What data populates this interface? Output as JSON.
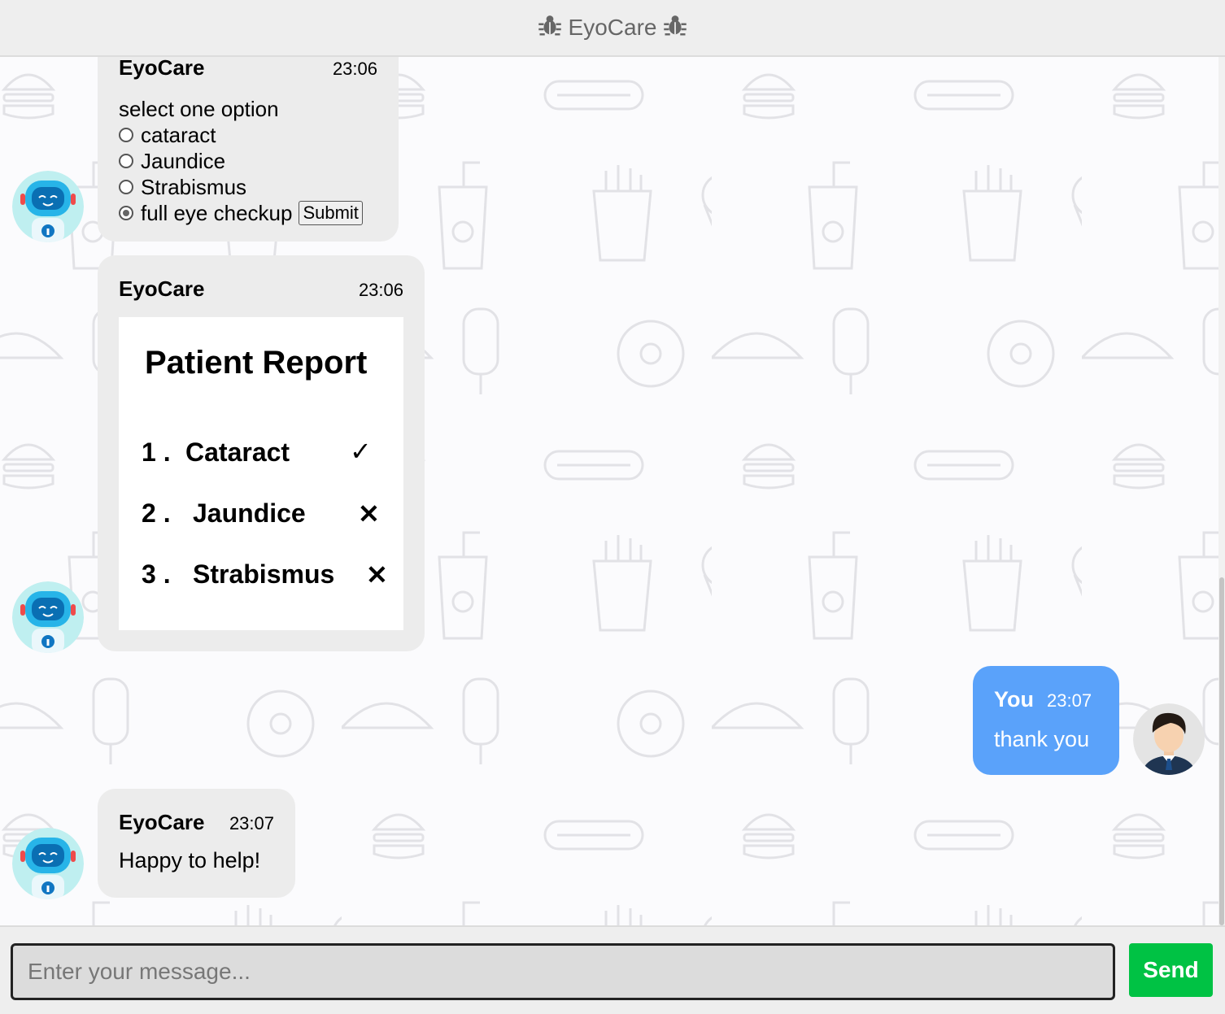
{
  "header": {
    "title": "EyoCare",
    "left_icon": "bug-icon",
    "right_icon": "bug-icon"
  },
  "messages": {
    "m1": {
      "sender": "EyoCare",
      "time": "23:06",
      "prompt": "select one option",
      "options": [
        "cataract",
        "Jaundice",
        "Strabismus",
        "full eye checkup"
      ],
      "selected": "full eye checkup",
      "submit_label": "Submit"
    },
    "m2": {
      "sender": "EyoCare",
      "time": "23:06",
      "report": {
        "title": "Patient Report",
        "rows": [
          {
            "num": "1 .",
            "name": "Cataract",
            "mark": "✓"
          },
          {
            "num": "2 .",
            "name": "Jaundice",
            "mark": "✕"
          },
          {
            "num": "3 .",
            "name": "Strabismus",
            "mark": "✕"
          }
        ]
      }
    },
    "m3": {
      "sender": "You",
      "time": "23:07",
      "text": "thank you"
    },
    "m4": {
      "sender": "EyoCare",
      "time": "23:07",
      "text": "Happy to help!"
    }
  },
  "composer": {
    "placeholder": "Enter your message...",
    "send_label": "Send"
  },
  "colors": {
    "user_bubble": "#5aa2fa",
    "bot_bubble": "#ececec",
    "send_button": "#00c244"
  }
}
